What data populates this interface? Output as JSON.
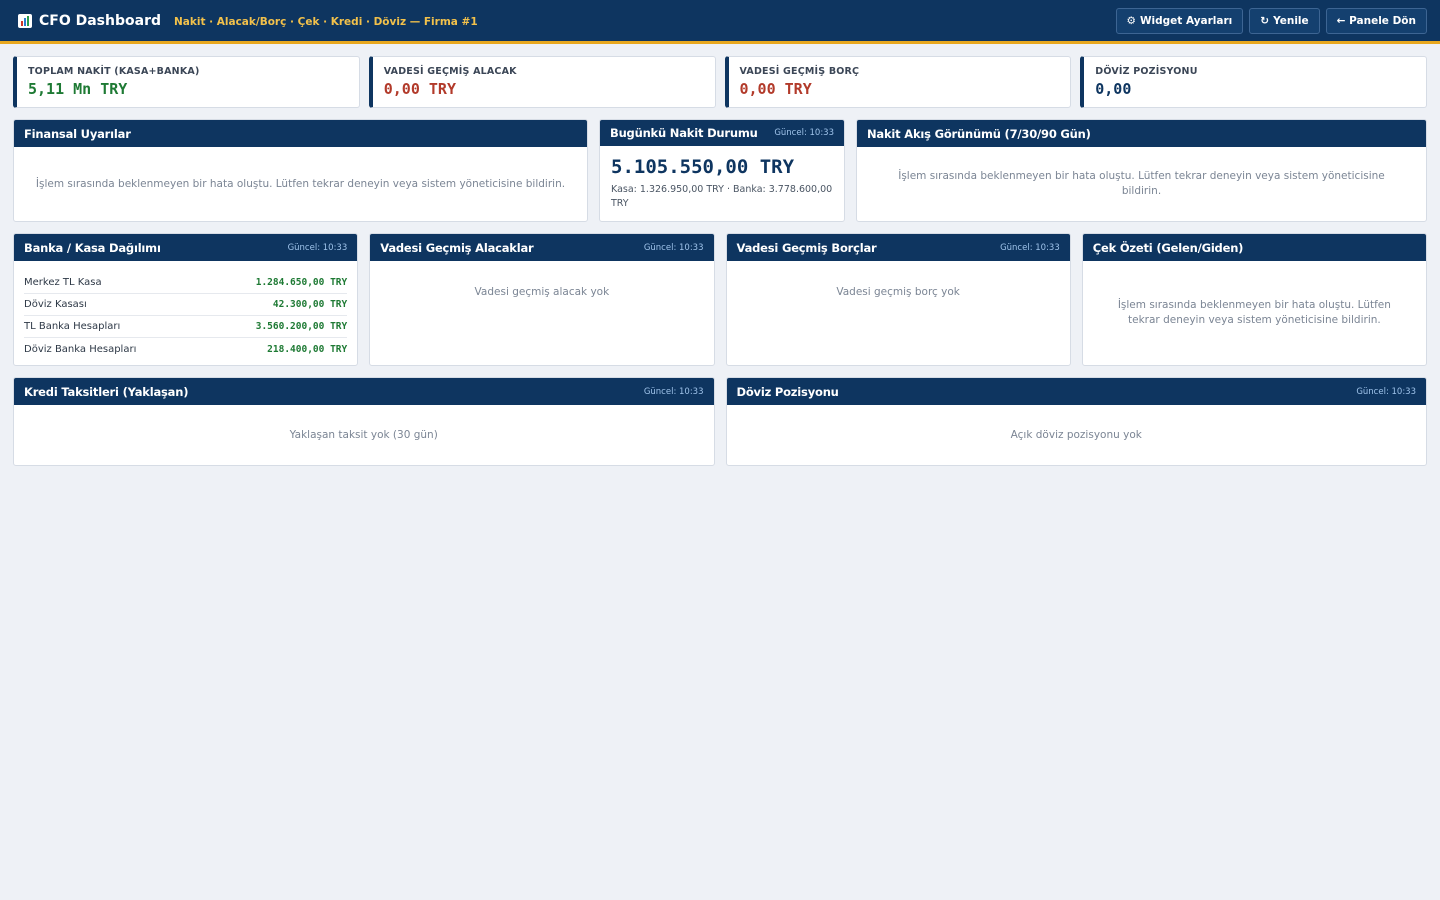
{
  "header": {
    "title": "CFO Dashboard",
    "subtitle": "Nakit · Alacak/Borç · Çek · Kredi · Döviz — Firma #1",
    "buttons": {
      "widget_settings": "Widget Ayarları",
      "refresh": "Yenile",
      "back": "← Panele Dön"
    }
  },
  "kpis": [
    {
      "label": "TOPLAM NAKİT (KASA+BANKA)",
      "value": "5,11 Mn TRY"
    },
    {
      "label": "VADESİ GEÇMİŞ ALACAK",
      "value": "0,00 TRY"
    },
    {
      "label": "VADESİ GEÇMİŞ BORÇ",
      "value": "0,00 TRY"
    },
    {
      "label": "DÖVİZ POZİSYONU",
      "value": "0,00"
    }
  ],
  "error_message": "İşlem sırasında beklenmeyen bir hata oluştu. Lütfen tekrar deneyin veya sistem yöneticisine bildirin.",
  "widgets": {
    "alerts": {
      "title": "Finansal Uyarılar"
    },
    "today": {
      "title": "Bugünkü Nakit Durumu",
      "time": "Güncel: 10:33",
      "amount": "5.105.550,00 TRY",
      "detail": "Kasa: 1.326.950,00 TRY · Banka: 3.778.600,00 TRY"
    },
    "cashflow": {
      "title": "Nakit Akış Görünümü (7/30/90 Gün)"
    },
    "distribution": {
      "title": "Banka / Kasa Dağılımı",
      "time": "Güncel: 10:33",
      "items": [
        {
          "name": "Merkez TL Kasa",
          "value": "1.284.650,00 TRY"
        },
        {
          "name": "Döviz Kasası",
          "value": "42.300,00 TRY"
        },
        {
          "name": "TL Banka Hesapları",
          "value": "3.560.200,00 TRY"
        },
        {
          "name": "Döviz Banka Hesapları",
          "value": "218.400,00 TRY"
        }
      ]
    },
    "receivables": {
      "title": "Vadesi Geçmiş Alacaklar",
      "time": "Güncel: 10:33",
      "empty": "Vadesi geçmiş alacak yok"
    },
    "payables": {
      "title": "Vadesi Geçmiş Borçlar",
      "time": "Güncel: 10:33",
      "empty": "Vadesi geçmiş borç yok"
    },
    "cheques": {
      "title": "Çek Özeti (Gelen/Giden)"
    },
    "loans": {
      "title": "Kredi Taksitleri (Yaklaşan)",
      "time": "Güncel: 10:33",
      "empty": "Yaklaşan taksit yok (30 gün)"
    },
    "fx": {
      "title": "Döviz Pozisyonu",
      "time": "Güncel: 10:33",
      "empty": "Açık döviz pozisyonu yok"
    }
  }
}
